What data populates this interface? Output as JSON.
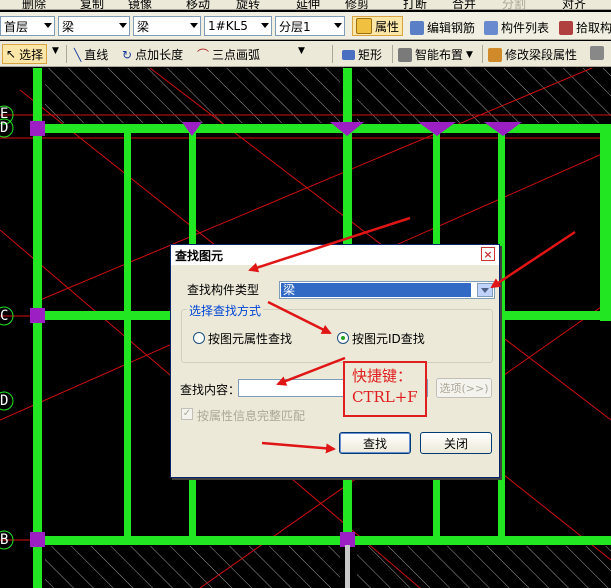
{
  "toolbar_top": {
    "items": [
      "删除",
      "复制",
      "镜像",
      "移动",
      "旋转",
      "延伸",
      "修剪",
      "打断",
      "合并",
      "分割",
      "对齐"
    ]
  },
  "toolbar_mid": {
    "floor": "首层",
    "category": "梁",
    "subcategory": "梁",
    "component": "1#KL5",
    "layer": "分层1",
    "properties": "属性",
    "edit_rebar": "编辑钢筋",
    "component_list": "构件列表",
    "pick": "拾取构"
  },
  "toolbar_draw": {
    "select": "选择",
    "line": "直线",
    "point_length": "点加长度",
    "three_point_arc": "三点画弧",
    "rect": "矩形",
    "smart_layout": "智能布置",
    "modify_span": "修改梁段属性"
  },
  "axes": {
    "E": "E",
    "D1": "D",
    "C": "C",
    "D2": "D",
    "B": "B"
  },
  "dialog": {
    "title": "查找图元",
    "close": "×",
    "type_label": "查找构件类型",
    "type_value": "梁",
    "group_title": "选择查找方式",
    "radio_attr": "按图元属性查找",
    "radio_id": "按图元ID查找",
    "content_label": "查找内容：",
    "content_value": "",
    "options": "选项(>>)",
    "full_match": "按属性信息完整匹配",
    "find": "查找",
    "close_btn": "关闭"
  },
  "annotation": {
    "line1": "快捷键：",
    "line2": "CTRL+F"
  },
  "colors": {
    "beam": "#22e622",
    "column": "#9c1fc4",
    "axis_line": "#d01010",
    "hatch": "#9a9a9a",
    "arrow": "#e01515"
  }
}
